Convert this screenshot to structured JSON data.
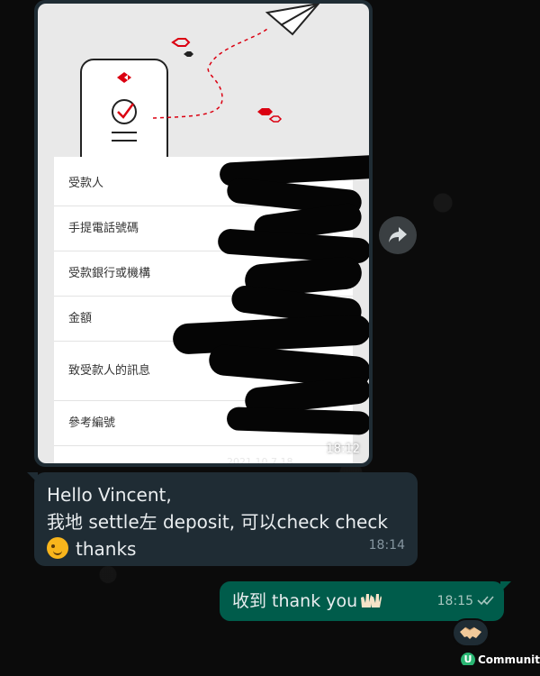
{
  "image_message": {
    "form_rows": [
      "受款人",
      "手提電話號碼",
      "受款銀行或機構",
      "金額",
      "致受款人的訊息",
      "參考編號"
    ],
    "time": "18:12",
    "partial_text": "2021 10 7 18"
  },
  "incoming_message": {
    "line1": "Hello Vincent,",
    "line2": "我地 settle左 deposit, 可以check check",
    "line3": "thanks",
    "time": "18:14",
    "emoji": "winking-face"
  },
  "outgoing_message": {
    "text": "收到 thank you",
    "emoji": "clapping-hands",
    "time": "18:15",
    "status": "read"
  },
  "reaction": {
    "emoji": "handshake"
  },
  "watermark": {
    "letter": "U",
    "text": "Community"
  },
  "colors": {
    "incoming_bubble": "#1f2c34",
    "outgoing_bubble": "#005c4b",
    "background": "#0b0b0b",
    "accent_red": "#db0011"
  }
}
